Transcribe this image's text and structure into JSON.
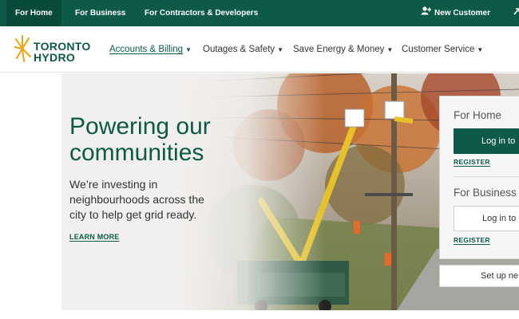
{
  "topbar": {
    "tabs": [
      {
        "label": "For Home",
        "active": true
      },
      {
        "label": "For Business",
        "active": false
      },
      {
        "label": "For Contractors & Developers",
        "active": false
      }
    ],
    "new_customer": "New Customer",
    "new_customer_icon": "add-user-icon",
    "extra_icon": "external-arrow-icon"
  },
  "logo": {
    "line1": "TORONTO",
    "line2": "HYDRO"
  },
  "nav": {
    "items": [
      {
        "label": "Accounts & Billing",
        "active": true
      },
      {
        "label": "Outages & Safety",
        "active": false
      },
      {
        "label": "Save Energy & Money",
        "active": false
      },
      {
        "label": "Customer Service",
        "active": false
      }
    ],
    "caret_icon": "caret-down-icon"
  },
  "hero": {
    "heading": "Powering our communities",
    "body": "We’re investing in neighbourhoods across the city to help get grid ready.",
    "cta": "LEARN MORE"
  },
  "login": {
    "home_title": "For Home",
    "home_button": "Log in to",
    "home_register": "REGISTER",
    "business_title": "For Business",
    "business_button": "Log in to",
    "business_register": "REGISTER",
    "setup_button": "Set up ne"
  },
  "colors": {
    "brand_green": "#0c5a47",
    "logo_orange": "#f2a20c"
  }
}
